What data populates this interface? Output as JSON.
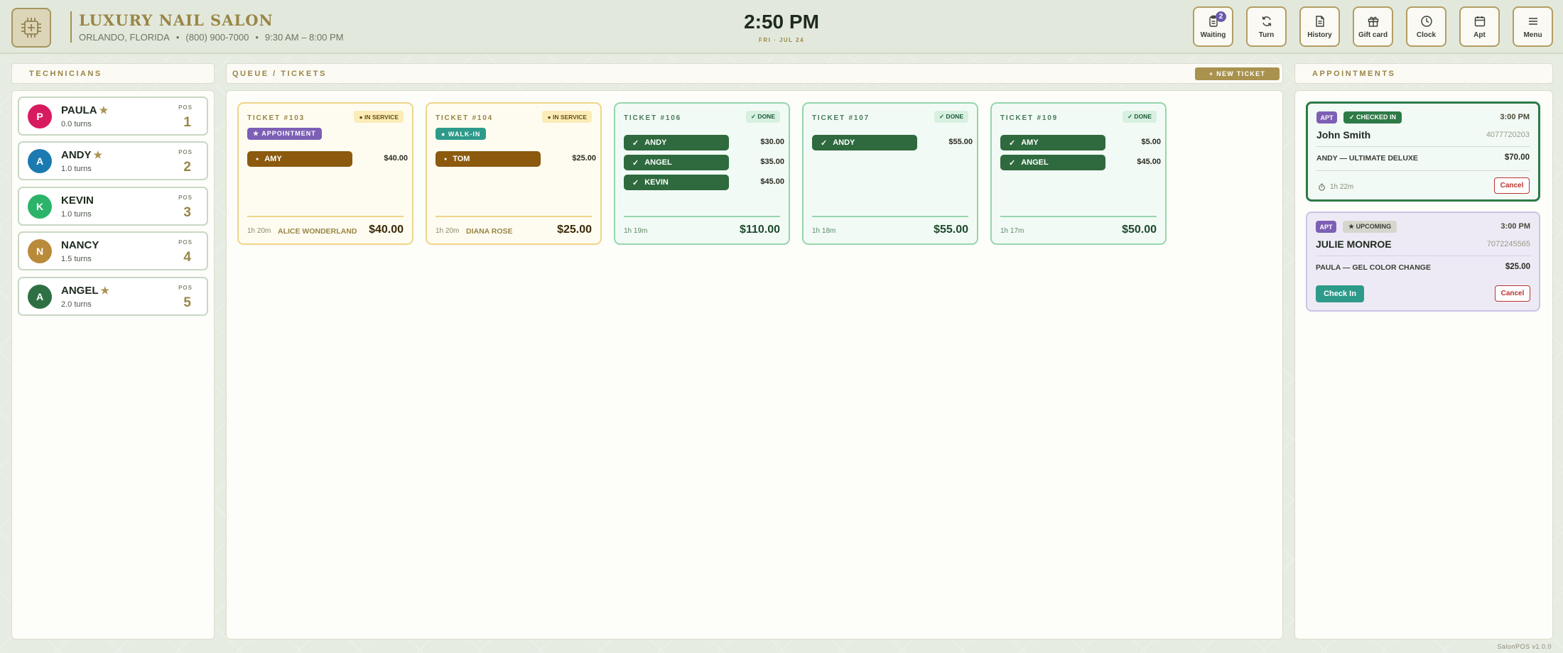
{
  "header": {
    "brand_title": "LUXURY NAIL SALON",
    "city": "ORLANDO, FLORIDA",
    "phone": "(800) 900-7000",
    "hours": "9:30 AM – 8:00 PM",
    "separator": "•",
    "logo_icon": "chip-icon",
    "time": "2:50 PM",
    "date": "FRI · JUL 24",
    "buttons": [
      {
        "label": "Waiting",
        "icon": "clipboard-icon",
        "badge": "2"
      },
      {
        "label": "Turn",
        "icon": "refresh-icon"
      },
      {
        "label": "History",
        "icon": "document-icon"
      },
      {
        "label": "Gift card",
        "icon": "gift-icon"
      },
      {
        "label": "Clock",
        "icon": "clock-icon"
      },
      {
        "label": "Apt",
        "icon": "calendar-icon"
      },
      {
        "label": "Menu",
        "icon": "menu-icon"
      }
    ]
  },
  "technicians": {
    "heading": "TECHNICIANS",
    "pos_label": "POS",
    "star_glyph": "★",
    "items": [
      {
        "initial": "P",
        "name": "PAULA",
        "starred": true,
        "turns": "0.0 turns",
        "pos": "1",
        "color": "#d81b60"
      },
      {
        "initial": "A",
        "name": "ANDY",
        "starred": true,
        "turns": "1.0 turns",
        "pos": "2",
        "color": "#1b7ab0"
      },
      {
        "initial": "K",
        "name": "KEVIN",
        "starred": false,
        "turns": "1.0 turns",
        "pos": "3",
        "color": "#2bb36a"
      },
      {
        "initial": "N",
        "name": "NANCY",
        "starred": false,
        "turns": "1.5 turns",
        "pos": "4",
        "color": "#b88a3a"
      },
      {
        "initial": "A",
        "name": "ANGEL",
        "starred": true,
        "turns": "2.0 turns",
        "pos": "5",
        "color": "#2e7044"
      }
    ]
  },
  "queue": {
    "heading": "QUEUE / TICKETS",
    "new_ticket": "+ NEW TICKET",
    "tickets": [
      {
        "title": "TICKET #103",
        "status": "● IN SERVICE",
        "kind": "svc",
        "type": "★ APPOINTMENT",
        "type_color": "#7d5fb5",
        "services": [
          {
            "tech": "AMY",
            "price": "$40.00"
          }
        ],
        "duration": "1h 20m",
        "client": "ALICE WONDERLAND",
        "total": "$40.00"
      },
      {
        "title": "TICKET #104",
        "status": "● IN SERVICE",
        "kind": "svc",
        "type": "● WALK-IN",
        "type_color": "#2e9a8a",
        "services": [
          {
            "tech": "TOM",
            "price": "$25.00"
          }
        ],
        "duration": "1h 20m",
        "client": "DIANA ROSE",
        "total": "$25.00"
      },
      {
        "title": "TICKET #106",
        "status": "✓ DONE",
        "kind": "done",
        "services": [
          {
            "tech": "ANDY",
            "price": "$30.00"
          },
          {
            "tech": "ANGEL",
            "price": "$35.00"
          },
          {
            "tech": "KEVIN",
            "price": "$45.00"
          }
        ],
        "duration": "1h 19m",
        "total": "$110.00"
      },
      {
        "title": "TICKET #107",
        "status": "✓ DONE",
        "kind": "done",
        "services": [
          {
            "tech": "ANDY",
            "price": "$55.00"
          }
        ],
        "duration": "1h 18m",
        "total": "$55.00"
      },
      {
        "title": "TICKET #109",
        "status": "✓ DONE",
        "kind": "done",
        "services": [
          {
            "tech": "AMY",
            "price": "$5.00"
          },
          {
            "tech": "ANGEL",
            "price": "$45.00"
          }
        ],
        "duration": "1h 17m",
        "total": "$50.00"
      }
    ]
  },
  "appointments": {
    "heading": "APPOINTMENTS",
    "items": [
      {
        "tag": "APT",
        "status": "✓ CHECKED IN",
        "time": "3:00 PM",
        "name": "John Smith",
        "phone": "4077720203",
        "service": "ANDY — ULTIMATE DELUXE",
        "price": "$70.00",
        "elapsed": "1h 22m",
        "cancel": "Cancel"
      },
      {
        "tag": "APT",
        "status": "★ UPCOMING",
        "time": "3:00 PM",
        "name": "JULIE MONROE",
        "phone": "7072245565",
        "service": "PAULA — GEL COLOR CHANGE",
        "price": "$25.00",
        "checkin": "Check In",
        "cancel": "Cancel"
      }
    ]
  },
  "footer": {
    "version": "SalonPOS v1.0.0"
  }
}
